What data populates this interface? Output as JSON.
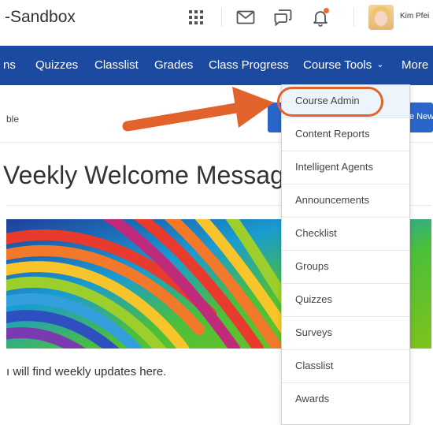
{
  "header": {
    "course_title": "-Sandbox",
    "user_name": "Kim Pfei",
    "icons": [
      "grid-icon",
      "mail-icon",
      "chat-icon",
      "bell-icon"
    ]
  },
  "nav": {
    "items": [
      {
        "label": "ns"
      },
      {
        "label": "Quizzes"
      },
      {
        "label": "Classlist"
      },
      {
        "label": "Grades"
      },
      {
        "label": "Class Progress"
      },
      {
        "label": "Course Tools"
      },
      {
        "label": "More"
      }
    ]
  },
  "subbar": {
    "left_text": "ble",
    "new_button_label": "e New"
  },
  "content": {
    "heading": "Veekly Welcome Messag",
    "body_text": "ı will find weekly updates here."
  },
  "dropdown": {
    "items": [
      {
        "label": "Course Admin"
      },
      {
        "label": "Content Reports"
      },
      {
        "label": "Intelligent Agents"
      },
      {
        "label": "Announcements"
      },
      {
        "label": "Checklist"
      },
      {
        "label": "Groups"
      },
      {
        "label": "Quizzes"
      },
      {
        "label": "Surveys"
      },
      {
        "label": "Classlist"
      },
      {
        "label": "Awards"
      }
    ]
  },
  "colors": {
    "nav_bg": "#1c4aa0",
    "accent_orange": "#e1622b",
    "button_blue": "#2a66c9"
  }
}
